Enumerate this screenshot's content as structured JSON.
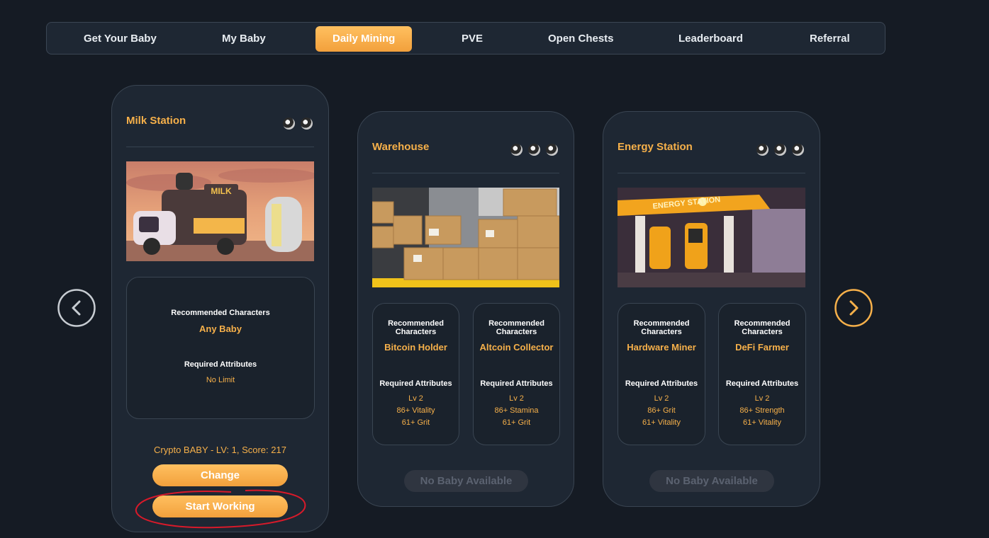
{
  "nav": {
    "items": [
      {
        "label": "Get Your Baby"
      },
      {
        "label": "My Baby"
      },
      {
        "label": "Daily Mining"
      },
      {
        "label": "PVE"
      },
      {
        "label": "Open Chests"
      },
      {
        "label": "Leaderboard"
      },
      {
        "label": "Referral"
      }
    ],
    "active_index": 2,
    "accent_color": "#f6b04a"
  },
  "cards": [
    {
      "title": "Milk Station",
      "coin_count": 2,
      "scene": "milk-truck",
      "recommended": [
        {
          "label": "Recommended Characters",
          "value": "Any Baby",
          "attr_label": "Required Attributes",
          "attrs": [
            "No Limit"
          ]
        }
      ],
      "assigned": "Crypto BABY - LV: 1, Score: 217",
      "buttons": {
        "change": "Change",
        "start": "Start Working"
      }
    },
    {
      "title": "Warehouse",
      "coin_count": 3,
      "scene": "warehouse-boxes",
      "recommended": [
        {
          "label": "Recommended Characters",
          "value": "Bitcoin Holder",
          "attr_label": "Required Attributes",
          "attrs": [
            "Lv 2",
            "86+ Vitality",
            "61+ Grit"
          ]
        },
        {
          "label": "Recommended Characters",
          "value": "Altcoin Collector",
          "attr_label": "Required Attributes",
          "attrs": [
            "Lv 2",
            "86+ Stamina",
            "61+ Grit"
          ]
        }
      ],
      "button": "No Baby Available"
    },
    {
      "title": "Energy Station",
      "coin_count": 3,
      "scene": "energy-station",
      "recommended": [
        {
          "label": "Recommended Characters",
          "value": "Hardware Miner",
          "attr_label": "Required Attributes",
          "attrs": [
            "Lv 2",
            "86+ Grit",
            "61+ Vitality"
          ]
        },
        {
          "label": "Recommended Characters",
          "value": "DeFi Farmer",
          "attr_label": "Required Attributes",
          "attrs": [
            "Lv 2",
            "86+ Strength",
            "61+ Vitality"
          ]
        }
      ],
      "button": "No Baby Available"
    }
  ],
  "arrows": {
    "prev_icon": "chevron-left-icon",
    "next_icon": "chevron-right-icon",
    "next_color": "#f6b04a",
    "prev_color": "#c7ccd2"
  }
}
